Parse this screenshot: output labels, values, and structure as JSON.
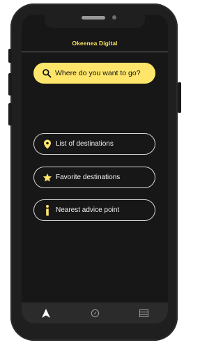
{
  "app": {
    "title": "Okeenea Digital"
  },
  "search": {
    "label": "Where do you want to go?",
    "icon": "search-icon"
  },
  "menu": {
    "items": [
      {
        "label": "List of destinations",
        "icon": "map-pin-icon"
      },
      {
        "label": "Favorite destinations",
        "icon": "star-icon"
      },
      {
        "label": "Nearest advice point",
        "icon": "info-icon"
      }
    ]
  },
  "bottom_nav": {
    "tabs": [
      {
        "name": "navigate",
        "icon": "navigation-arrow-icon",
        "active": true
      },
      {
        "name": "compass",
        "icon": "compass-icon",
        "active": false
      },
      {
        "name": "menu",
        "icon": "list-icon",
        "active": false
      }
    ]
  },
  "colors": {
    "accent": "#ffe66b",
    "title": "#f6e05e",
    "background": "#171717",
    "bar": "#2b2b2b",
    "border": "#d7d7d7"
  }
}
